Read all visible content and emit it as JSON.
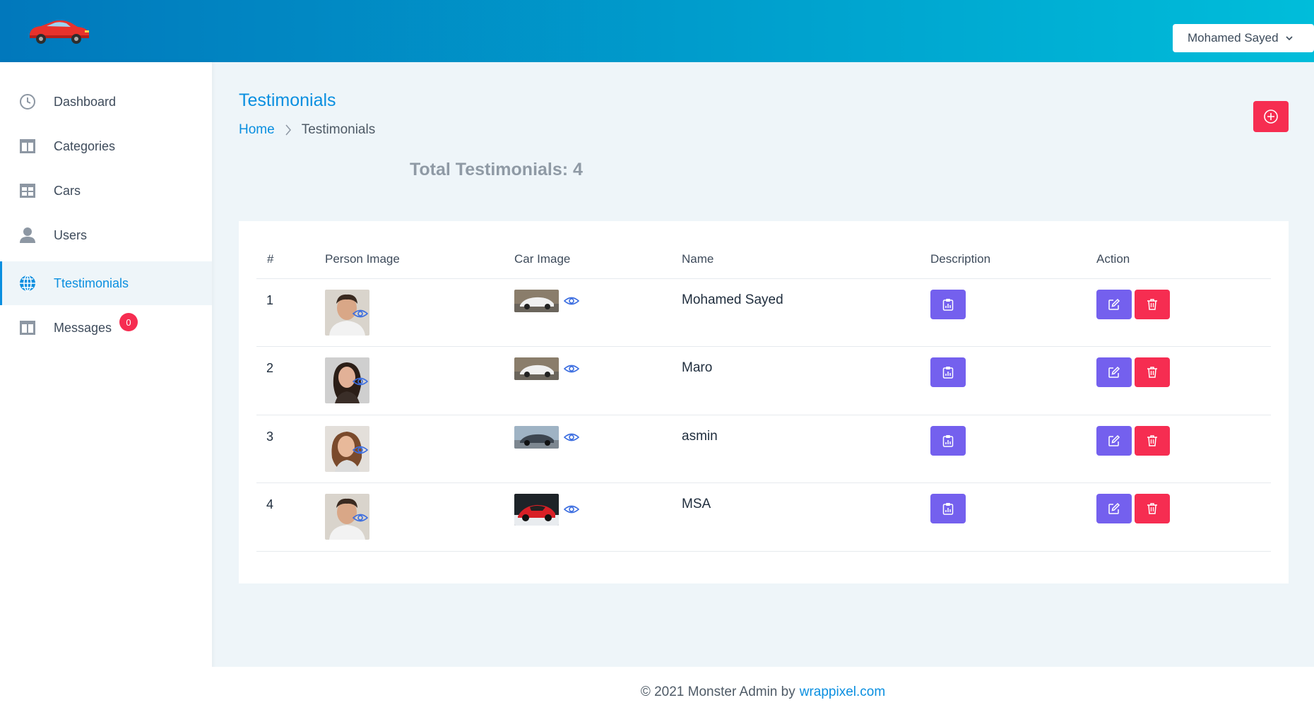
{
  "topbar": {
    "user_name": "Mohamed Sayed",
    "logo_icon": "car-logo-icon",
    "chevron_icon": "chevron-down-icon"
  },
  "sidebar": {
    "items": [
      {
        "label": "Dashboard",
        "icon": "clock-icon"
      },
      {
        "label": "Categories",
        "icon": "columns-icon"
      },
      {
        "label": "Cars",
        "icon": "table-grid-icon"
      },
      {
        "label": "Users",
        "icon": "user-icon"
      },
      {
        "label": "Ttestimonials",
        "icon": "globe-icon",
        "active": true
      },
      {
        "label": "Messages",
        "icon": "columns-icon",
        "badge": "0"
      }
    ]
  },
  "header": {
    "title": "Testimonials",
    "breadcrumb_home": "Home",
    "breadcrumb_current": "Testimonials",
    "add_icon": "plus-circle-icon"
  },
  "summary": {
    "total_text": "Total Testimonials: 4"
  },
  "table": {
    "columns": [
      "#",
      "Person Image",
      "Car Image",
      "Name",
      "Description",
      "Action"
    ],
    "rows": [
      {
        "num": "1",
        "name": "Mohamed Sayed"
      },
      {
        "num": "2",
        "name": "Maro"
      },
      {
        "num": "3",
        "name": "asmin"
      },
      {
        "num": "4",
        "name": "MSA"
      }
    ],
    "view_icon": "eye-icon",
    "description_icon": "clipboard-chart-icon",
    "edit_icon": "edit-icon",
    "delete_icon": "trash-icon"
  },
  "footer": {
    "text": "© 2021 Monster Admin by",
    "link": "wrappixel.com"
  },
  "colors": {
    "primary": "#0a8fe0",
    "danger": "#f62d51",
    "purple": "#7460ee",
    "background": "#eef5f9"
  }
}
